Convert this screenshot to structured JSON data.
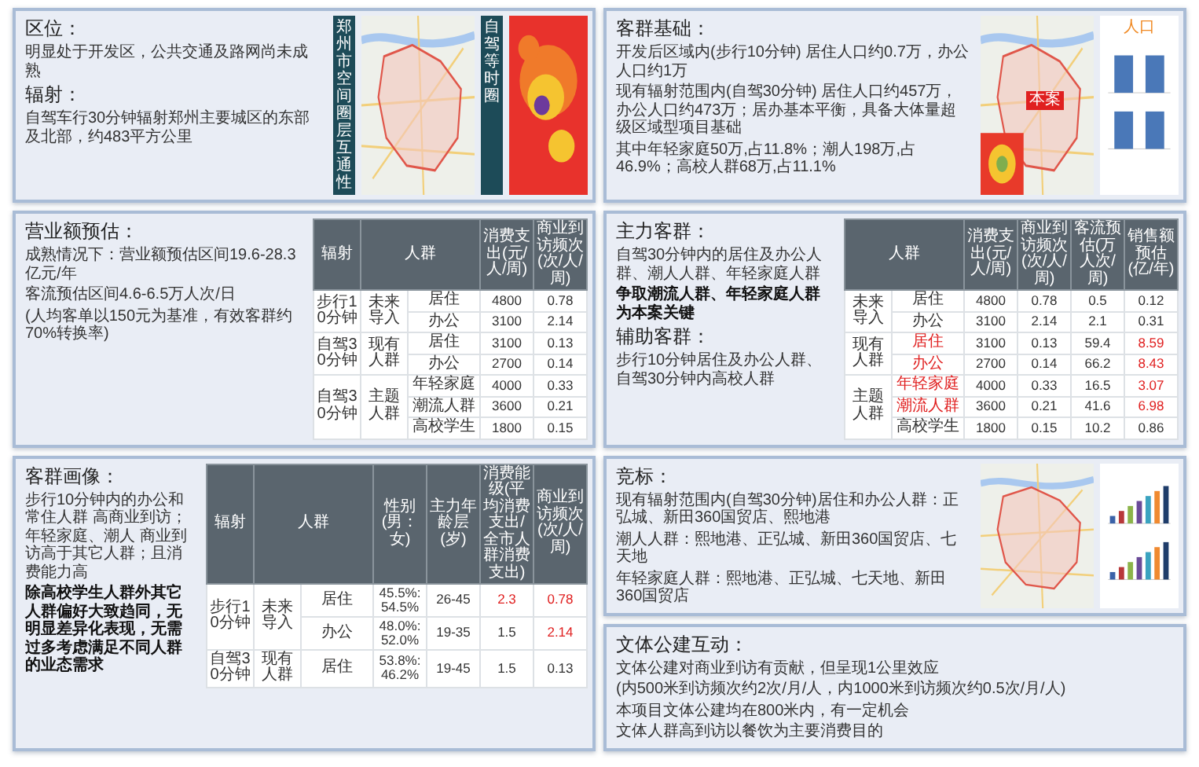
{
  "slides": [
    {
      "panels": [
        {
          "kind": "text",
          "blocks": [
            {
              "kind": "heading",
              "text": "区位：",
              "bold": false
            },
            {
              "kind": "paragraph",
              "text": "明显处于开发区，公共交通及路网尚未成熟",
              "bold": false
            },
            {
              "kind": "heading",
              "text": "辐射：",
              "bold": false
            },
            {
              "kind": "paragraph",
              "text": "自驾车行30分钟辐射郑州主要城区的东部及北部，约483平方公里",
              "bold": false
            }
          ]
        },
        {
          "kind": "banner",
          "text": "郑州市空间圈层互通性"
        },
        {
          "kind": "map",
          "inset": false
        },
        {
          "kind": "banner",
          "text": "自驾等时圈"
        },
        {
          "kind": "heatmap"
        }
      ]
    },
    {
      "panels": [
        {
          "kind": "text",
          "blocks": [
            {
              "kind": "heading",
              "text": "客群基础：",
              "bold": false
            },
            {
              "kind": "paragraph",
              "text": "开发后区域内(步行10分钟) 居住人口约0.7万，办公人口约1万",
              "bold": false
            },
            {
              "kind": "paragraph",
              "text": "现有辐射范围内(自驾30分钟) 居住人口约457万，办公人口约473万；居办基本平衡，具备大体量超级区域型项目基础",
              "bold": false
            },
            {
              "kind": "paragraph",
              "text": "其中年轻家庭50万,占11.8%；潮人198万,占46.9%；高校人群68万,占11.1%",
              "bold": false
            }
          ]
        },
        {
          "kind": "map",
          "label": "本案",
          "inset": true
        },
        {
          "kind": "bar_chart",
          "title": "人口"
        }
      ]
    },
    {
      "panels": [
        {
          "kind": "text",
          "blocks": [
            {
              "kind": "heading",
              "text": "营业额预估：",
              "bold": false
            },
            {
              "kind": "paragraph",
              "text": "成熟情况下：营业额预估区间19.6-28.3亿元/年",
              "bold": false
            },
            {
              "kind": "paragraph",
              "text": "客流预估区间4.6-6.5万人次/日",
              "bold": false
            },
            {
              "kind": "paragraph",
              "text": "(人均客单以150元为基准，有效客群约70%转换率)",
              "bold": false
            }
          ]
        },
        {
          "kind": "table",
          "columns": [
            {
              "kind": "radius",
              "text": "辐射"
            },
            {
              "kind": "group",
              "text": "人群"
            },
            {
              "kind": "value",
              "text": "消费支出(元/人/周)"
            },
            {
              "kind": "value",
              "text": "商业到访频次(次/人/周)"
            }
          ],
          "groups": [
            {
              "radius": "步行10分钟",
              "name": "未来导入",
              "items": [
                {
                  "name": "居住",
                  "highlight": false,
                  "values": [
                    {
                      "text": "4800",
                      "highlight": false
                    },
                    {
                      "text": "0.78",
                      "highlight": false
                    }
                  ]
                },
                {
                  "name": "办公",
                  "highlight": false,
                  "values": [
                    {
                      "text": "3100",
                      "highlight": false
                    },
                    {
                      "text": "2.14",
                      "highlight": false
                    }
                  ]
                }
              ]
            },
            {
              "radius": "自驾30分钟",
              "name": "现有人群",
              "items": [
                {
                  "name": "居住",
                  "highlight": false,
                  "values": [
                    {
                      "text": "3100",
                      "highlight": false
                    },
                    {
                      "text": "0.13",
                      "highlight": false
                    }
                  ]
                },
                {
                  "name": "办公",
                  "highlight": false,
                  "values": [
                    {
                      "text": "2700",
                      "highlight": false
                    },
                    {
                      "text": "0.14",
                      "highlight": false
                    }
                  ]
                }
              ]
            },
            {
              "radius": "自驾30分钟",
              "name": "主题人群",
              "items": [
                {
                  "name": "年轻家庭",
                  "highlight": false,
                  "values": [
                    {
                      "text": "4000",
                      "highlight": false
                    },
                    {
                      "text": "0.33",
                      "highlight": false
                    }
                  ]
                },
                {
                  "name": "潮流人群",
                  "highlight": false,
                  "values": [
                    {
                      "text": "3600",
                      "highlight": false
                    },
                    {
                      "text": "0.21",
                      "highlight": false
                    }
                  ]
                },
                {
                  "name": "高校学生",
                  "highlight": false,
                  "values": [
                    {
                      "text": "1800",
                      "highlight": false
                    },
                    {
                      "text": "0.15",
                      "highlight": false
                    }
                  ]
                }
              ]
            }
          ]
        }
      ]
    },
    {
      "panels": [
        {
          "kind": "text",
          "blocks": [
            {
              "kind": "heading",
              "text": "主力客群：",
              "bold": false
            },
            {
              "kind": "paragraph",
              "text": "自驾30分钟内的居住及办公人群、潮人人群、年轻家庭人群",
              "bold": false
            },
            {
              "kind": "paragraph",
              "text": "争取潮流人群、年轻家庭人群为本案关键",
              "bold": true
            },
            {
              "kind": "heading",
              "text": "辅助客群：",
              "bold": false
            },
            {
              "kind": "paragraph",
              "text": "步行10分钟居住及办公人群、自驾30分钟内高校人群",
              "bold": false
            }
          ]
        },
        {
          "kind": "table",
          "columns": [
            {
              "kind": "group",
              "text": "人群"
            },
            {
              "kind": "value",
              "text": "消费支出(元/人/周)"
            },
            {
              "kind": "value",
              "text": "商业到访频次(次/人/周)"
            },
            {
              "kind": "value",
              "text": "客流预估(万人次/周)"
            },
            {
              "kind": "value",
              "text": "销售额预估(亿/年)"
            }
          ],
          "groups": [
            {
              "name": "未来导入",
              "items": [
                {
                  "name": "居住",
                  "highlight": false,
                  "values": [
                    {
                      "text": "4800",
                      "highlight": false
                    },
                    {
                      "text": "0.78",
                      "highlight": false
                    },
                    {
                      "text": "0.5",
                      "highlight": false
                    },
                    {
                      "text": "0.12",
                      "highlight": false
                    }
                  ]
                },
                {
                  "name": "办公",
                  "highlight": false,
                  "values": [
                    {
                      "text": "3100",
                      "highlight": false
                    },
                    {
                      "text": "2.14",
                      "highlight": false
                    },
                    {
                      "text": "2.1",
                      "highlight": false
                    },
                    {
                      "text": "0.31",
                      "highlight": false
                    }
                  ]
                }
              ]
            },
            {
              "name": "现有人群",
              "items": [
                {
                  "name": "居住",
                  "highlight": true,
                  "values": [
                    {
                      "text": "3100",
                      "highlight": false
                    },
                    {
                      "text": "0.13",
                      "highlight": false
                    },
                    {
                      "text": "59.4",
                      "highlight": false
                    },
                    {
                      "text": "8.59",
                      "highlight": true
                    }
                  ]
                },
                {
                  "name": "办公",
                  "highlight": true,
                  "values": [
                    {
                      "text": "2700",
                      "highlight": false
                    },
                    {
                      "text": "0.14",
                      "highlight": false
                    },
                    {
                      "text": "66.2",
                      "highlight": false
                    },
                    {
                      "text": "8.43",
                      "highlight": true
                    }
                  ]
                }
              ]
            },
            {
              "name": "主题人群",
              "items": [
                {
                  "name": "年轻家庭",
                  "highlight": true,
                  "values": [
                    {
                      "text": "4000",
                      "highlight": false
                    },
                    {
                      "text": "0.33",
                      "highlight": false
                    },
                    {
                      "text": "16.5",
                      "highlight": false
                    },
                    {
                      "text": "3.07",
                      "highlight": true
                    }
                  ]
                },
                {
                  "name": "潮流人群",
                  "highlight": true,
                  "values": [
                    {
                      "text": "3600",
                      "highlight": false
                    },
                    {
                      "text": "0.21",
                      "highlight": false
                    },
                    {
                      "text": "41.6",
                      "highlight": false
                    },
                    {
                      "text": "6.98",
                      "highlight": true
                    }
                  ]
                },
                {
                  "name": "高校学生",
                  "highlight": false,
                  "values": [
                    {
                      "text": "1800",
                      "highlight": false
                    },
                    {
                      "text": "0.15",
                      "highlight": false
                    },
                    {
                      "text": "10.2",
                      "highlight": false
                    },
                    {
                      "text": "0.86",
                      "highlight": false
                    }
                  ]
                }
              ]
            }
          ]
        }
      ]
    },
    {
      "panels": [
        {
          "kind": "text",
          "blocks": [
            {
              "kind": "heading",
              "text": "客群画像：",
              "bold": false
            },
            {
              "kind": "paragraph",
              "text": "步行10分钟内的办公和常住人群 高商业到访；年轻家庭、潮人 商业到访高于其它人群；且消费能力高",
              "bold": false
            },
            {
              "kind": "paragraph",
              "text": "除高校学生人群外其它人群偏好大致趋同，无明显差异化表现，无需过多考虑满足不同人群的业态需求",
              "bold": true
            }
          ]
        },
        {
          "kind": "table",
          "columns": [
            {
              "kind": "radius",
              "text": "辐射"
            },
            {
              "kind": "group",
              "text": "人群"
            },
            {
              "kind": "value",
              "text": "性别(男：女)"
            },
            {
              "kind": "value",
              "text": "主力年龄层(岁)"
            },
            {
              "kind": "value",
              "text": "消费能级(平均消费支出/全市人群消费支出)"
            },
            {
              "kind": "value",
              "text": "商业到访频次(次/人/周)"
            }
          ],
          "groups": [
            {
              "radius": "步行10分钟",
              "name": "未来导入",
              "items": [
                {
                  "name": "居住",
                  "highlight": false,
                  "values": [
                    {
                      "text": "45.5%: 54.5%",
                      "highlight": false
                    },
                    {
                      "text": "26-45",
                      "highlight": false
                    },
                    {
                      "text": "2.3",
                      "highlight": true
                    },
                    {
                      "text": "0.78",
                      "highlight": true
                    }
                  ]
                },
                {
                  "name": "办公",
                  "highlight": false,
                  "values": [
                    {
                      "text": "48.0%: 52.0%",
                      "highlight": false
                    },
                    {
                      "text": "19-35",
                      "highlight": false
                    },
                    {
                      "text": "1.5",
                      "highlight": false
                    },
                    {
                      "text": "2.14",
                      "highlight": true
                    }
                  ]
                }
              ]
            },
            {
              "radius": "自驾30分钟",
              "name": "现有人群",
              "items": [
                {
                  "name": "居住",
                  "highlight": false,
                  "values": [
                    {
                      "text": "53.8%: 46.2%",
                      "highlight": false
                    },
                    {
                      "text": "19-45",
                      "highlight": false
                    },
                    {
                      "text": "1.5",
                      "highlight": false
                    },
                    {
                      "text": "0.13",
                      "highlight": false
                    }
                  ]
                }
              ]
            }
          ]
        }
      ]
    },
    {
      "panels": [
        {
          "kind": "text",
          "blocks": [
            {
              "kind": "heading",
              "text": "竞标：",
              "bold": false
            },
            {
              "kind": "paragraph",
              "text": "现有辐射范围内(自驾30分钟)居住和办公人群：正弘城、新田360国贸店、熙地港",
              "bold": false
            },
            {
              "kind": "paragraph",
              "text": "潮人人群：熙地港、正弘城、新田360国贸店、七天地",
              "bold": false
            },
            {
              "kind": "paragraph",
              "text": "年轻家庭人群：熙地港、正弘城、七天地、新田360国贸店",
              "bold": false
            }
          ]
        },
        {
          "kind": "map",
          "inset": false
        },
        {
          "kind": "color_bar_chart"
        }
      ]
    },
    {
      "panels": [
        {
          "kind": "text",
          "blocks": [
            {
              "kind": "heading",
              "text": "文体公建互动：",
              "bold": false
            },
            {
              "kind": "paragraph",
              "text": "文体公建对商业到访有贡献，但呈现1公里效应",
              "bold": false
            },
            {
              "kind": "paragraph",
              "text": "(内500米到访频次约2次/月/人，内1000米到访频次约0.5次/月/人)",
              "bold": false
            },
            {
              "kind": "paragraph",
              "text": "本项目文体公建均在800米内，有一定机会",
              "bold": false
            },
            {
              "kind": "paragraph",
              "text": "文体人群高到访以餐饮为主要消费目的",
              "bold": false
            }
          ]
        }
      ]
    }
  ]
}
